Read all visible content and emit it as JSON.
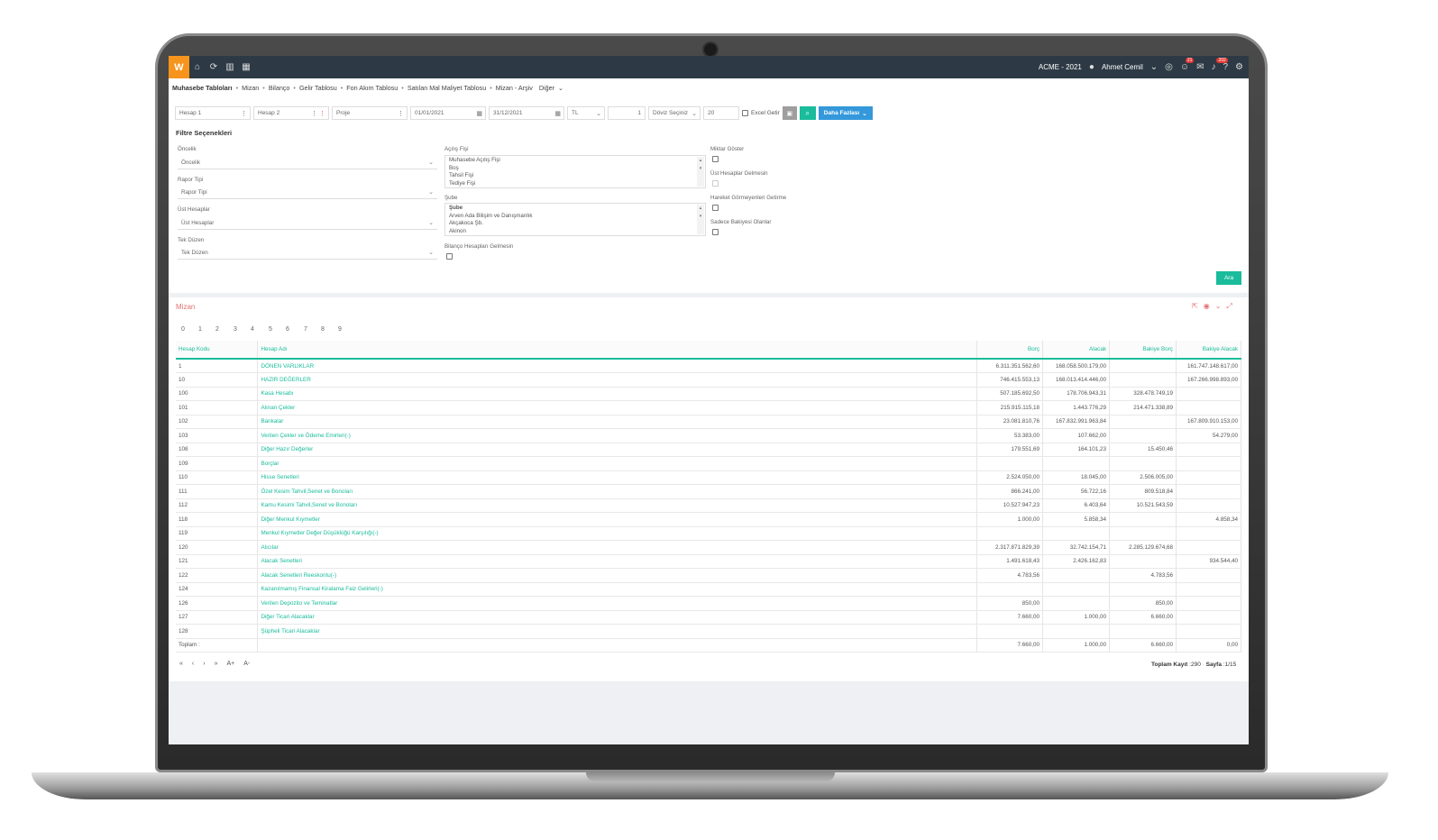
{
  "app": {
    "logo": "W",
    "company": "ACME - 2021",
    "user": "Ahmet Cemil",
    "badges": {
      "chat": "21",
      "notifications": "202"
    }
  },
  "breadcrumb": {
    "items": [
      "Muhasebe Tabloları",
      "Mizan",
      "Bilanço",
      "Gelir Tablosu",
      "Fon Akım Tablosu",
      "Satılan Mal Maliyet Tablosu",
      "Mizan - Arşiv",
      "Diğer"
    ]
  },
  "toolbar": {
    "hesap1": "Hesap 1",
    "hesap2": "Hesap 2",
    "proje": "Proje",
    "date_start": "01/01/2021",
    "date_end": "31/12/2021",
    "currency": "TL",
    "rate": "1",
    "doviz": "Döviz Seçiniz",
    "page_size": "20",
    "excel": "Excel Getir",
    "more": "Daha Fazlası"
  },
  "filters": {
    "title": "Filtre Seçenekleri",
    "oncelik_label": "Öncelik",
    "oncelik_value": "Öncelik",
    "rapor_label": "Rapor Tipi",
    "rapor_value": "Rapor Tipi",
    "ust_label": "Üst Hesaplar",
    "ust_value": "Üst Hesaplar",
    "tek_label": "Tek Düzen",
    "tek_value": "Tek Düzen",
    "acilis_label": "Açılış Fişi",
    "acilis_options": [
      "Muhasebe Açılış Fişi",
      "Boş",
      "Tahsil Fişi",
      "Tediye Fişi"
    ],
    "sube_label": "Şube",
    "sube_options": [
      "Şube",
      "Arven Ada Bilişim ve Danışmanlık",
      "Akçakoca Şb.",
      "Akinon"
    ],
    "bilanco_label": "Bilanço Hesapları Gelmesin",
    "miktar_label": "Miktar Göster",
    "ust_gelmesin_label": "Üst Hesaplar Gelmesin",
    "hareket_label": "Hareket Görmeyenleri Getirme",
    "sadece_label": "Sadece Bakiyesi Olanlar",
    "search": "Ara"
  },
  "mizan": {
    "title": "Mizan",
    "digits": [
      "0",
      "1",
      "2",
      "3",
      "4",
      "5",
      "6",
      "7",
      "8",
      "9"
    ],
    "columns": [
      "Hesap Kodu",
      "Hesap Adı",
      "Borç",
      "Alacak",
      "Bakiye Borç",
      "Bakiye Alacak"
    ],
    "rows": [
      [
        "1",
        "DÖNEN VARLIKLAR",
        "6.311.351.562,60",
        "168.058.500.179,00",
        "",
        "161.747.148.617,00"
      ],
      [
        "10",
        "HAZIR DEĞERLER",
        "746.415.553,13",
        "168.013.414.446,00",
        "",
        "167.266.998.893,00"
      ],
      [
        "100",
        "Kasa Hesabı",
        "507.185.692,50",
        "178.706.943,31",
        "328.478.749,19",
        ""
      ],
      [
        "101",
        "Alınan Çekler",
        "215.915.115,18",
        "1.443.776,29",
        "214.471.338,89",
        ""
      ],
      [
        "102",
        "Bankalar",
        "23.081.810,76",
        "167.832.991.963,84",
        "",
        "167.809.910.153,00"
      ],
      [
        "103",
        "Verilen Çekler ve Ödeme Emirleri(-)",
        "53.383,00",
        "107.662,00",
        "",
        "54.279,00"
      ],
      [
        "108",
        "Diğer Hazır Değerler",
        "179.551,69",
        "164.101,23",
        "15.450,46",
        ""
      ],
      [
        "109",
        "Borçlar",
        "",
        "",
        "",
        ""
      ],
      [
        "110",
        "Hisse Senetleri",
        "2.524.050,00",
        "18.045,00",
        "2.506.005,00",
        ""
      ],
      [
        "111",
        "Özel Kesim Tahvil,Senet ve Bonoları",
        "866.241,00",
        "56.722,16",
        "809.518,84",
        ""
      ],
      [
        "112",
        "Kamu Kesimi Tahvil,Senet ve Bonoları",
        "10.527.947,23",
        "6.403,64",
        "10.521.543,59",
        ""
      ],
      [
        "118",
        "Diğer Menkul Kıymetler",
        "1.000,00",
        "5.858,34",
        "",
        "4.858,34"
      ],
      [
        "119",
        "Menkul Kıymetler Değer Düşüklüğü Karşılığı(-)",
        "",
        "",
        "",
        ""
      ],
      [
        "120",
        "Alıcılar",
        "2.317.871.829,39",
        "32.742.154,71",
        "2.285.129.674,68",
        ""
      ],
      [
        "121",
        "Alacak Senetleri",
        "1.491.618,43",
        "2.426.162,83",
        "",
        "934.544,40"
      ],
      [
        "122",
        "Alacak Senetleri Reeskontu(-)",
        "4.783,56",
        "",
        "4.783,56",
        ""
      ],
      [
        "124",
        "Kazanılmamış Finansal Kiralama Faiz Gelirleri(-)",
        "",
        "",
        "",
        ""
      ],
      [
        "126",
        "Verilen Depozito ve Teminatlar",
        "850,00",
        "",
        "850,00",
        ""
      ],
      [
        "127",
        "Diğer Ticari Alacaklar",
        "7.660,00",
        "1.000,00",
        "6.660,00",
        ""
      ],
      [
        "128",
        "Şüpheli Ticari Alacaklar",
        "",
        "",
        "",
        ""
      ]
    ],
    "total_row": [
      "Toplam :",
      "",
      "7.660,00",
      "1.000,00",
      "6.660,00",
      "0,00"
    ],
    "pager": [
      "«",
      "‹",
      "›",
      "»",
      "A+",
      "A-"
    ],
    "total_label": "Toplam Kayıt",
    "total_value": ":290",
    "page_label": "Sayfa",
    "page_value": ":1/15"
  }
}
